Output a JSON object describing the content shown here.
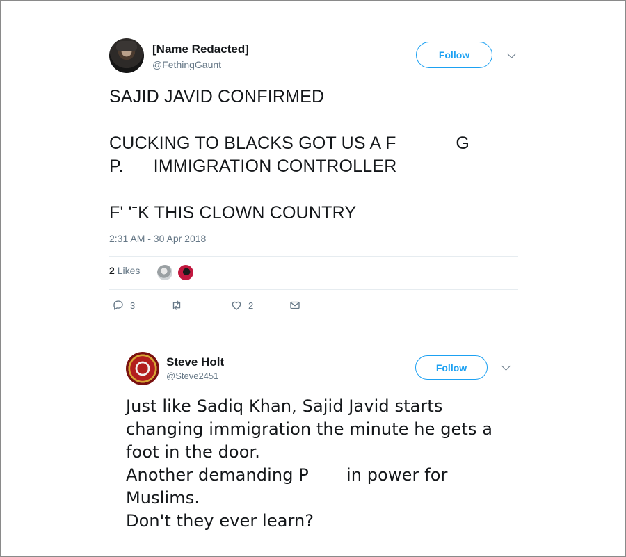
{
  "tweet1": {
    "author_name": "[Name Redacted]",
    "author_handle": "@FethingGaunt",
    "follow_label": "Follow",
    "lines": [
      "SAJID JAVID CONFIRMED",
      "CUCKING TO BLACKS GOT US A F            G",
      "P.      IMMIGRATION CONTROLLER",
      "F' 'ˉK THIS CLOWN COUNTRY"
    ],
    "timestamp": "2:31 AM - 30 Apr 2018",
    "likes_count": "2",
    "likes_label": "Likes",
    "reply_count": "3",
    "retweet_count": "",
    "like_count": "2"
  },
  "tweet2": {
    "author_name": "Steve Holt",
    "author_handle": "@Steve2451",
    "follow_label": "Follow",
    "lines": [
      "Just like Sadiq Khan, Sajid Javid starts",
      "changing immigration the minute he gets a",
      "foot in the door.",
      "Another demanding P       in power for",
      "Muslims.",
      "Don't they ever learn?"
    ]
  },
  "colors": {
    "accent": "#1da1f2",
    "secondary_text": "#657786",
    "divider": "#e6ecf0"
  }
}
